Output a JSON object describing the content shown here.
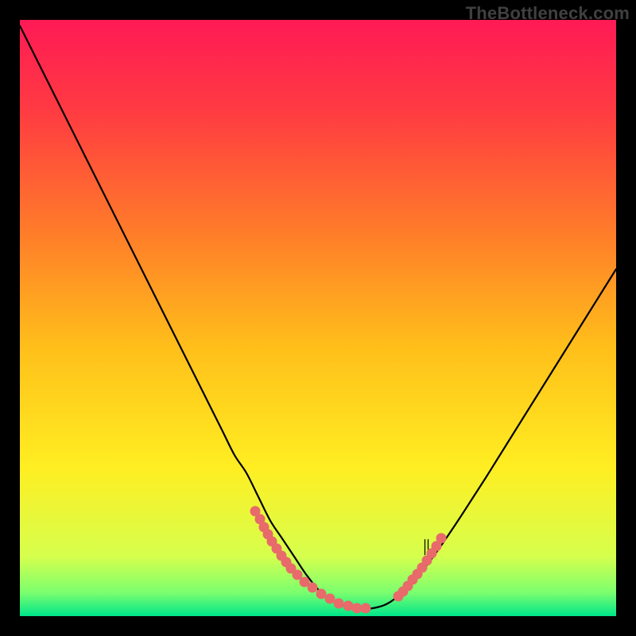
{
  "watermark": "TheBottleneck.com",
  "chart_data": {
    "type": "line",
    "title": "",
    "xlabel": "",
    "ylabel": "",
    "xlim": [
      0,
      100
    ],
    "ylim": [
      0,
      100
    ],
    "series": [
      {
        "name": "curve",
        "x": [
          0,
          2,
          4,
          6,
          8,
          10,
          12,
          14,
          16,
          18,
          20,
          22,
          24,
          26,
          28,
          30,
          32,
          34,
          36,
          38,
          40,
          42,
          44,
          46,
          48,
          50,
          51,
          52,
          53,
          54,
          55,
          56,
          57,
          58,
          59,
          60,
          61,
          62,
          63,
          64,
          66,
          68,
          70,
          72,
          74,
          76,
          78,
          80,
          82,
          84,
          86,
          88,
          90,
          92,
          94,
          96,
          98,
          100
        ],
        "y": [
          99,
          95,
          91,
          87,
          83,
          79,
          75,
          71,
          67,
          63,
          59,
          55,
          51,
          47,
          43,
          39,
          35,
          31,
          27,
          24,
          20,
          16,
          13,
          10,
          7,
          4.5,
          3.6,
          2.9,
          2.3,
          1.8,
          1.5,
          1.3,
          1.2,
          1.2,
          1.3,
          1.5,
          1.8,
          2.3,
          3.0,
          3.8,
          5.8,
          8.2,
          10.9,
          13.8,
          16.8,
          19.9,
          23.0,
          26.2,
          29.4,
          32.6,
          35.8,
          39.0,
          42.2,
          45.4,
          48.6,
          51.8,
          55.0,
          58.2
        ]
      },
      {
        "name": "left-highlight-dots",
        "x": [
          39.5,
          40.2,
          40.9,
          41.6,
          42.3,
          43.0,
          43.8,
          44.6,
          45.5,
          46.5,
          47.7,
          49.0,
          50.5,
          52.0,
          53.5,
          55.0,
          56.5,
          58.0
        ],
        "y": [
          17.6,
          16.3,
          15.0,
          13.8,
          12.6,
          11.4,
          10.2,
          9.1,
          8.0,
          6.9,
          5.8,
          4.8,
          3.8,
          2.9,
          2.2,
          1.7,
          1.4,
          1.4
        ]
      },
      {
        "name": "right-highlight-dots",
        "x": [
          63.5,
          64.3,
          65.1,
          65.9,
          66.7,
          67.5,
          68.3,
          69.1,
          69.9,
          70.7
        ],
        "y": [
          3.4,
          4.2,
          5.1,
          6.1,
          7.1,
          8.2,
          9.4,
          10.6,
          11.8,
          13.1
        ]
      },
      {
        "name": "tick-mark",
        "x": [
          68.2
        ],
        "y": [
          10.5
        ]
      }
    ],
    "gradient": {
      "stops": [
        {
          "offset": 0.0,
          "color": "#ff1a55"
        },
        {
          "offset": 0.15,
          "color": "#ff3a42"
        },
        {
          "offset": 0.35,
          "color": "#ff7a2a"
        },
        {
          "offset": 0.55,
          "color": "#ffbf1a"
        },
        {
          "offset": 0.75,
          "color": "#ffee22"
        },
        {
          "offset": 0.9,
          "color": "#d6ff4d"
        },
        {
          "offset": 0.96,
          "color": "#7cff6e"
        },
        {
          "offset": 1.0,
          "color": "#00e58a"
        }
      ]
    }
  }
}
